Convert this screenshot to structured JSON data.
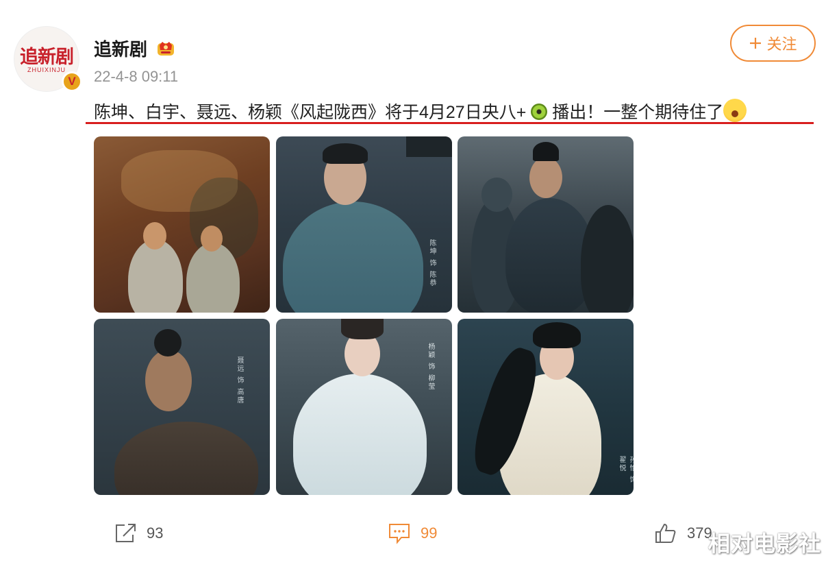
{
  "author": {
    "avatar_logo_text": "追新剧",
    "avatar_logo_sub": "ZHUIXINJU",
    "name": "追新剧",
    "verified_badge": "V",
    "timestamp": "22-4-8 09:11"
  },
  "follow_button": {
    "label": "关注",
    "icon": "plus-icon"
  },
  "post": {
    "text_main": "陈坤、白宇、聂远、杨颖《风起陇西》将于4月27日央八+",
    "text_end": "播出！一整个期待住了",
    "inline_icons": [
      "kiwi-icon",
      "crying-face-emoji"
    ]
  },
  "photos": [
    {
      "caption": ""
    },
    {
      "caption": "陈坤 饰 陈恭"
    },
    {
      "caption": ""
    },
    {
      "caption": "聂远 饰 高唐"
    },
    {
      "caption": "杨颖 饰 柳莹"
    },
    {
      "caption": "孙怡 饰 翟悦"
    }
  ],
  "actions": {
    "share_count": "93",
    "comment_count": "99",
    "like_count": "379"
  },
  "watermark": "相对电影社",
  "colors": {
    "accent_orange": "#f08a36",
    "underline_red": "#d81e1e",
    "timestamp_gray": "#939393",
    "verified_gold": "#e8a31b"
  }
}
